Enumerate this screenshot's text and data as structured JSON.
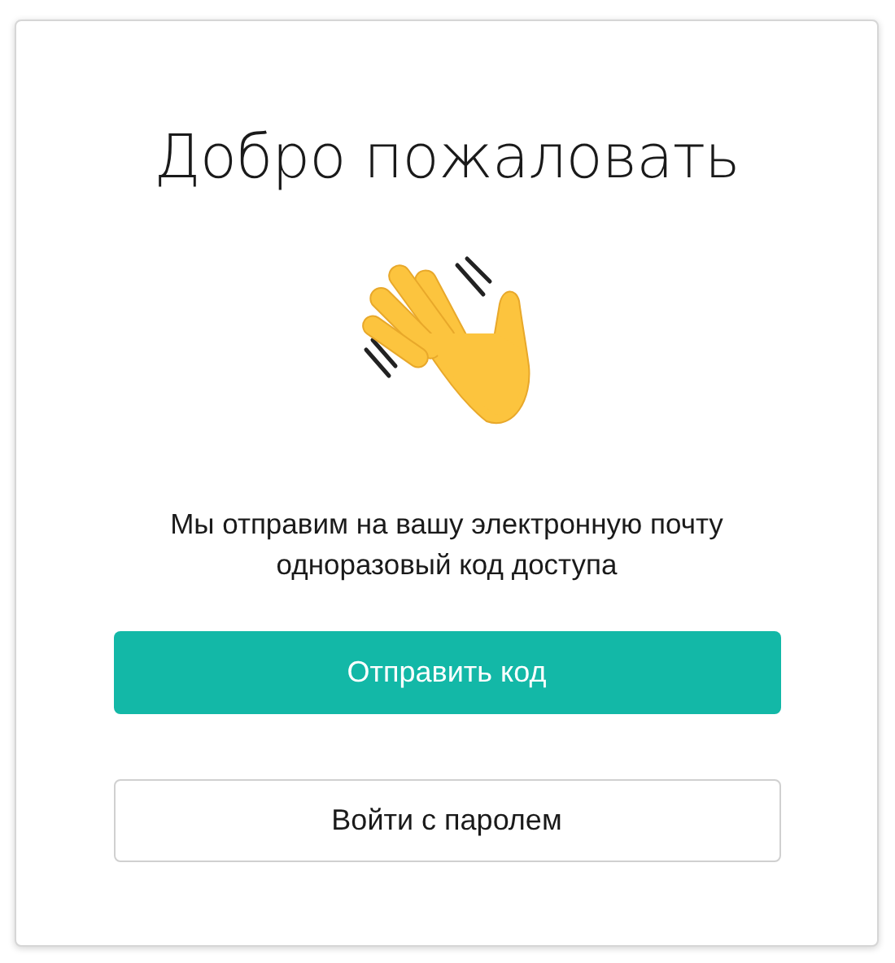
{
  "title": "Добро пожаловать",
  "message": "Мы отправим на вашу электронную почту одноразовый код доступа",
  "buttons": [
    {
      "label": "Отправить код",
      "kind": "primary"
    },
    {
      "label": "Войти с паролем",
      "kind": "secondary"
    }
  ]
}
